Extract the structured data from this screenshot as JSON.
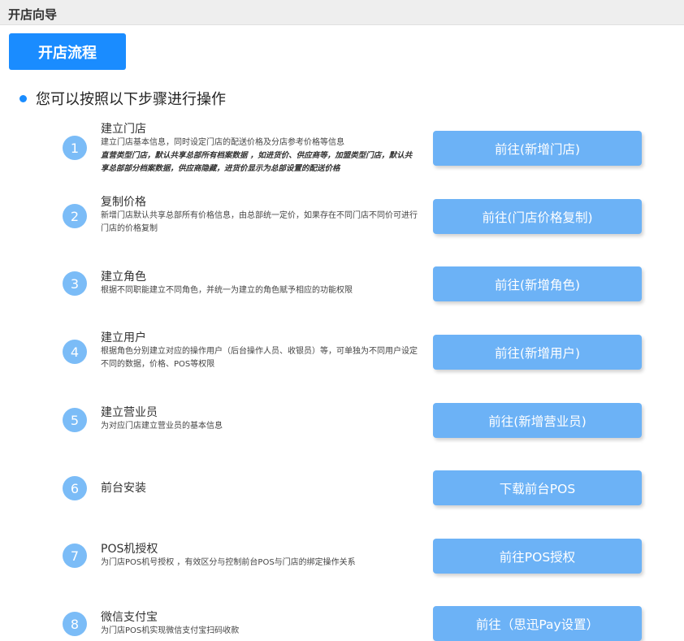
{
  "header": {
    "title": "开店向导"
  },
  "tab": {
    "label": "开店流程"
  },
  "intro": {
    "text": "您可以按照以下步骤进行操作"
  },
  "steps": [
    {
      "num": "1",
      "title": "建立门店",
      "desc": "建立门店基本信息，同时设定门店的配送价格及分店参考价格等信息",
      "note": "直营类型门店，默认共享总部所有档案数据 ，如进货价、供应商等，加盟类型门店，默认共享总部部分档案数据，供应商隐藏，进货价显示为总部设置的配送价格",
      "button": "前往(新增门店)"
    },
    {
      "num": "2",
      "title": "复制价格",
      "desc": "新增门店默认共享总部所有价格信息，由总部统一定价，如果存在不同门店不同价可进行门店的价格复制",
      "button": "前往(门店价格复制)"
    },
    {
      "num": "3",
      "title": "建立角色",
      "desc": "根据不同职能建立不同角色，并统一为建立的角色赋予相应的功能权限",
      "button": "前往(新增角色)"
    },
    {
      "num": "4",
      "title": "建立用户",
      "desc": "根据角色分别建立对应的操作用户（后台操作人员、收银员）等，可单独为不同用户设定不同的数据，价格、POS等权限",
      "button": "前往(新增用户)"
    },
    {
      "num": "5",
      "title": "建立营业员",
      "desc": "为对应门店建立营业员的基本信息",
      "button": "前往(新增营业员)"
    },
    {
      "num": "6",
      "title": "前台安装",
      "desc": "",
      "button": "下载前台POS"
    },
    {
      "num": "7",
      "title": "POS机授权",
      "desc": "为门店POS机号授权 ，有效区分与控制前台POS与门店的绑定操作关系",
      "button": "前往POS授权"
    },
    {
      "num": "8",
      "title": "微信支付宝",
      "desc": "为门店POS机实现微信支付宝扫码收款",
      "button": "前往（思迅Pay设置）"
    }
  ]
}
